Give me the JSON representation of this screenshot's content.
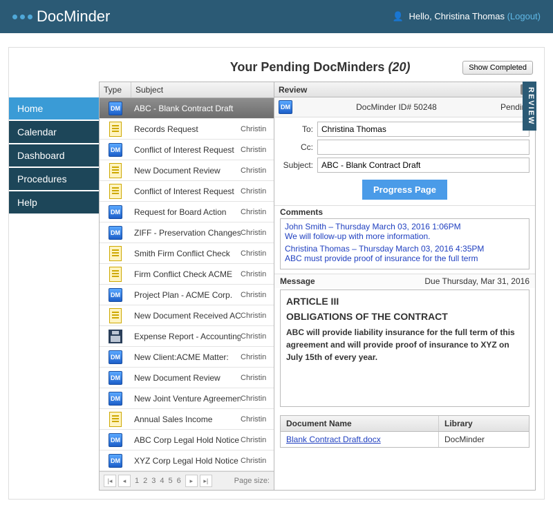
{
  "brand": "DocMinder",
  "user": {
    "greeting": "Hello, Christina Thomas",
    "logout": "(Logout)"
  },
  "nav": [
    {
      "label": "Home",
      "active": true
    },
    {
      "label": "Calendar",
      "active": false
    },
    {
      "label": "Dashboard",
      "active": false
    },
    {
      "label": "Procedures",
      "active": false
    },
    {
      "label": "Help",
      "active": false
    }
  ],
  "page_title_prefix": "Your Pending DocMinders ",
  "page_title_count": "(20)",
  "show_completed_label": "Show Completed",
  "list": {
    "headers": {
      "type": "Type",
      "subject": "Subject"
    },
    "rows": [
      {
        "icon": "dm",
        "subject": "ABC - Blank Contract Draft",
        "owner": "",
        "selected": true
      },
      {
        "icon": "doc",
        "subject": "Records Request",
        "owner": "Christin"
      },
      {
        "icon": "dm",
        "subject": "Conflict of Interest Request",
        "owner": "Christin"
      },
      {
        "icon": "doc",
        "subject": "New Document Review",
        "owner": "Christin"
      },
      {
        "icon": "doc",
        "subject": "Conflict of Interest Request",
        "owner": "Christin"
      },
      {
        "icon": "dm",
        "subject": "Request for Board Action",
        "owner": "Christin"
      },
      {
        "icon": "dm",
        "subject": "ZIFF - Preservation Changes",
        "owner": "Christin"
      },
      {
        "icon": "doc",
        "subject": "Smith Firm Conflict Check",
        "owner": "Christin"
      },
      {
        "icon": "doc",
        "subject": "Firm Conflict Check ACME",
        "owner": "Christin"
      },
      {
        "icon": "dm",
        "subject": "Project Plan - ACME Corp.",
        "owner": "Christin"
      },
      {
        "icon": "doc",
        "subject": "New Document Received ACME",
        "owner": "Christin"
      },
      {
        "icon": "disk",
        "subject": "Expense Report - Accounting",
        "owner": "Christin"
      },
      {
        "icon": "dm",
        "subject": "New Client:ACME Matter:",
        "owner": "Christin"
      },
      {
        "icon": "dm",
        "subject": "New Document Review",
        "owner": "Christin"
      },
      {
        "icon": "dm",
        "subject": "New Joint Venture Agreement",
        "owner": "Christin"
      },
      {
        "icon": "doc",
        "subject": "Annual Sales Income",
        "owner": "Christin"
      },
      {
        "icon": "dm",
        "subject": "ABC Corp Legal Hold Notice",
        "owner": "Christin"
      },
      {
        "icon": "dm",
        "subject": "XYZ Corp Legal Hold Notice",
        "owner": "Christin"
      }
    ],
    "pager": {
      "pages": [
        "1",
        "2",
        "3",
        "4",
        "5",
        "6"
      ],
      "page_size_label": "Page size:"
    }
  },
  "review": {
    "title": "Review",
    "id_label": "DocMinder ID# 50248",
    "status": "Pending",
    "to_label": "To:",
    "to_value": "Christina Thomas",
    "cc_label": "Cc:",
    "cc_value": "",
    "subject_label": "Subject:",
    "subject_value": "ABC - Blank Contract Draft",
    "progress_btn": "Progress Page",
    "comments_label": "Comments",
    "comments": [
      {
        "head": "John Smith – Thursday March 03, 2016 1:06PM",
        "body": "We will follow-up with more information."
      },
      {
        "head": "Christina Thomas – Thursday March 03, 2016 4:35PM",
        "body": "ABC must provide proof of insurance for the full term"
      }
    ],
    "message_label": "Message",
    "due_label": "Due Thursday, Mar 31, 2016",
    "msg_h1": "ARTICLE III",
    "msg_h2": "OBLIGATIONS OF THE CONTRACT",
    "msg_body": "ABC will provide liability insurance for the full term of this agreement and will provide proof of insurance to XYZ on July 15th of every year.",
    "doc_table": {
      "h1": "Document Name",
      "h2": "Library",
      "file": "Blank Contract Draft.docx",
      "lib": "DocMinder"
    },
    "side_tab": "REVIEW"
  }
}
